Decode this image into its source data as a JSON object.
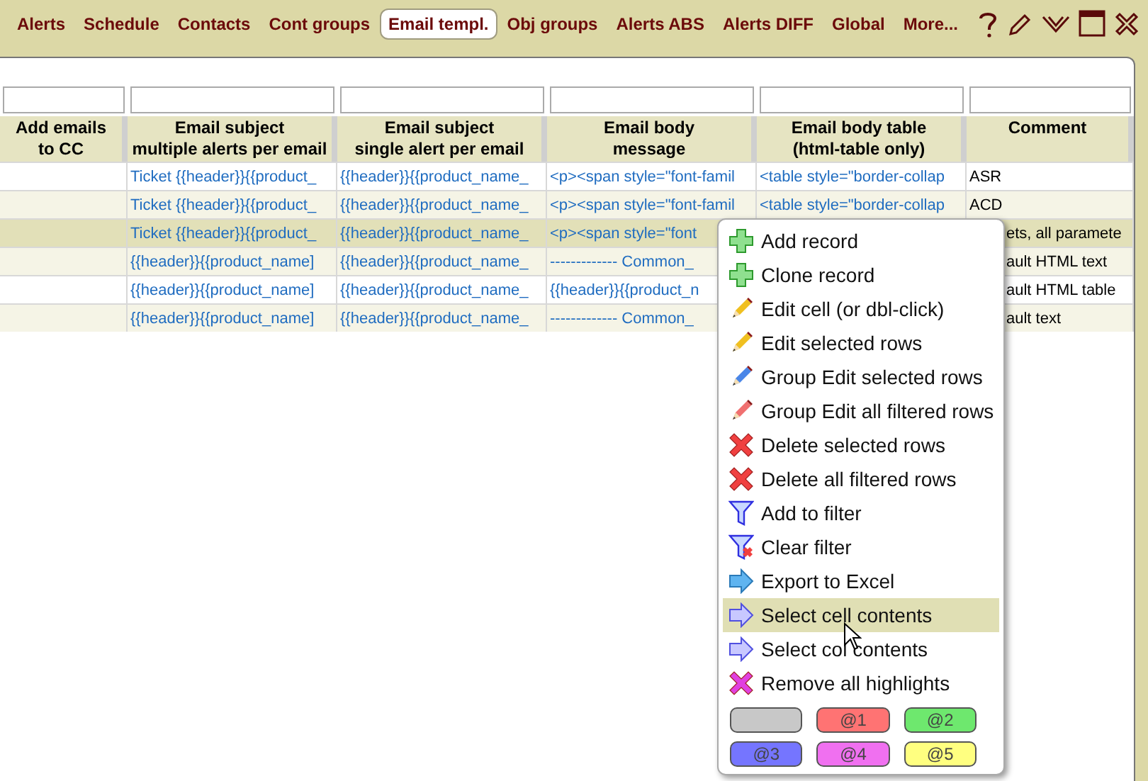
{
  "tabs": [
    {
      "label": "Alerts",
      "selected": false
    },
    {
      "label": "Schedule",
      "selected": false
    },
    {
      "label": "Contacts",
      "selected": false
    },
    {
      "label": "Cont groups",
      "selected": false
    },
    {
      "label": "Email templ.",
      "selected": true
    },
    {
      "label": "Obj groups",
      "selected": false
    },
    {
      "label": "Alerts ABS",
      "selected": false
    },
    {
      "label": "Alerts DIFF",
      "selected": false
    },
    {
      "label": "Global",
      "selected": false
    },
    {
      "label": "More...",
      "selected": false
    }
  ],
  "table": {
    "columns": [
      {
        "heading": "Add emails",
        "heading_2": "to CC"
      },
      {
        "heading": "Email subject",
        "heading_2": "multiple alerts per email"
      },
      {
        "heading": "Email subject",
        "heading_2": "single alert per email"
      },
      {
        "heading": "Email body",
        "heading_2": "message"
      },
      {
        "heading": "Email body table",
        "heading_2": "(html-table only)"
      },
      {
        "heading": "Comment"
      }
    ],
    "rows": [
      {
        "selected": false,
        "cells": [
          "",
          "Ticket {{header}}{{product_",
          "{{header}}{{product_name_",
          "<p><span style=\"font-famil",
          "<table style=\"border-collap",
          "ASR"
        ]
      },
      {
        "selected": false,
        "cells": [
          "",
          "Ticket {{header}}{{product_",
          "{{header}}{{product_name_",
          "<p><span style=\"font-famil",
          "<table style=\"border-collap",
          "ACD"
        ]
      },
      {
        "selected": true,
        "cells": [
          "",
          "Ticket {{header}}{{product_",
          "{{header}}{{product_name_",
          "<p><span style=\"font",
          "",
          "ets, all paramete"
        ]
      },
      {
        "selected": false,
        "cells": [
          "",
          "{{header}}{{product_name]",
          "{{header}}{{product_name_",
          "------------- Common_",
          "",
          "ault HTML text"
        ]
      },
      {
        "selected": false,
        "cells": [
          "",
          "{{header}}{{product_name]",
          "{{header}}{{product_name_",
          "{{header}}{{product_n",
          "",
          "ault HTML table"
        ]
      },
      {
        "selected": false,
        "cells": [
          "",
          "{{header}}{{product_name]",
          "{{header}}{{product_name_",
          "------------- Common_",
          "",
          "ault text"
        ]
      }
    ]
  },
  "context_menu": {
    "items": [
      {
        "label": "Add record",
        "kind": "plus",
        "selected": false
      },
      {
        "label": "Clone record",
        "kind": "plus",
        "selected": false
      },
      {
        "label": "Edit cell (or dbl-click)",
        "kind": "pencil",
        "selected": false
      },
      {
        "label": "Edit selected rows",
        "kind": "pencil",
        "selected": false
      },
      {
        "label": "Group Edit selected rows",
        "kind": "bluepencil",
        "selected": false
      },
      {
        "label": "Group Edit all filtered rows",
        "kind": "redpencil",
        "selected": false
      },
      {
        "label": "Delete selected rows",
        "kind": "cross",
        "selected": false
      },
      {
        "label": "Delete all filtered rows",
        "kind": "cross",
        "selected": false
      },
      {
        "label": "Add to filter",
        "kind": "funnel",
        "selected": false
      },
      {
        "label": "Clear filter",
        "kind": "funnelx",
        "selected": false
      },
      {
        "label": "Export to Excel",
        "kind": "arrow",
        "selected": false
      },
      {
        "label": "Select cell contents",
        "kind": "lightarrow",
        "selected": true
      },
      {
        "label": "Select col contents",
        "kind": "lightarrow",
        "selected": false
      },
      {
        "label": "Remove all highlights",
        "kind": "pinkcross",
        "selected": false
      }
    ],
    "highlights": [
      {
        "color": "#c8c8c8"
      },
      {
        "label": "@1",
        "color": "#ff7373"
      },
      {
        "label": "@2",
        "color": "#6ee86e"
      },
      {
        "label": "@3",
        "color": "#7575ff"
      },
      {
        "label": "@4",
        "color": "#f070f0"
      },
      {
        "label": "@5",
        "color": "#ffff80"
      }
    ]
  }
}
